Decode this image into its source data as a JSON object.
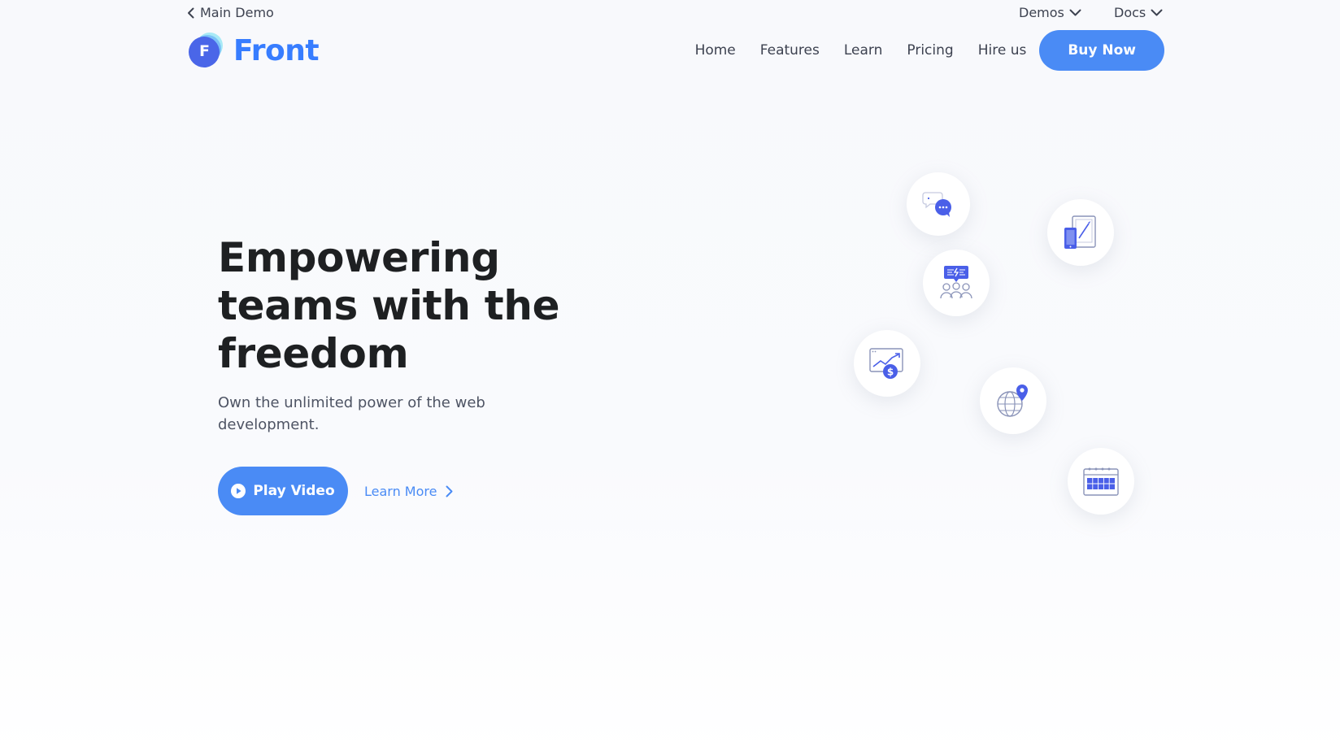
{
  "topbar": {
    "back_label": "Main Demo",
    "demos_label": "Demos",
    "docs_label": "Docs"
  },
  "brand": {
    "logo_letter": "F",
    "name": "Front",
    "color": "#377dff"
  },
  "nav": {
    "items": [
      {
        "label": "Home"
      },
      {
        "label": "Features"
      },
      {
        "label": "Learn"
      },
      {
        "label": "Pricing"
      },
      {
        "label": "Hire us"
      }
    ],
    "cta_label": "Buy Now"
  },
  "hero": {
    "title_lines": [
      "Empowering",
      "teams with the",
      "freedom"
    ],
    "subtitle": "Own the unlimited power of the web development.",
    "play_label": "Play Video",
    "learn_label": "Learn More"
  },
  "illustration_icons": [
    {
      "name": "chat-bubbles-icon"
    },
    {
      "name": "devices-icon"
    },
    {
      "name": "team-chat-icon"
    },
    {
      "name": "finance-chart-icon"
    },
    {
      "name": "globe-pin-icon"
    },
    {
      "name": "calendar-icon"
    }
  ],
  "colors": {
    "accent": "#4a8bf5",
    "icon_primary": "#4a5fe8",
    "text_dark": "#1e2022",
    "text_muted": "#4e5464"
  }
}
